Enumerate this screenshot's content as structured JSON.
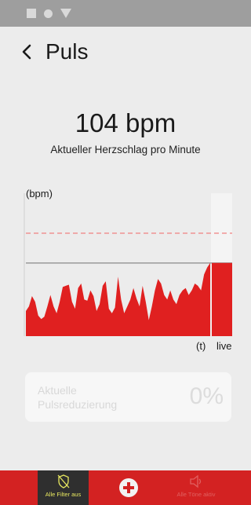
{
  "header": {
    "title": "Puls"
  },
  "heart_rate": {
    "value": "104 bpm",
    "caption": "Aktueller Herzschlag pro Minute"
  },
  "chart_data": {
    "type": "area",
    "ylabel": "(bpm)",
    "xlabel": "(t)",
    "live_label": "live",
    "series": [
      {
        "values": [
          62,
          66,
          75,
          70,
          58,
          55,
          57,
          66,
          76,
          66,
          60,
          70,
          83,
          84,
          85,
          70,
          64,
          82,
          86,
          72,
          71,
          80,
          75,
          62,
          68,
          84,
          88,
          64,
          60,
          65,
          92,
          72,
          60,
          66,
          72,
          82,
          73,
          66,
          84,
          70,
          54,
          66,
          80,
          90,
          86,
          76,
          72,
          80,
          72,
          68,
          76,
          80,
          82,
          76,
          80,
          86,
          84,
          80,
          94,
          100,
          104
        ]
      }
    ],
    "live_value": 104,
    "reference_value": 104,
    "threshold_value": 130,
    "ylim": [
      40,
      165
    ],
    "colors": {
      "fill": "#e02020",
      "threshold": "#f08a8a",
      "reference": "#9a9a9a",
      "live_band": "#f4f4f4"
    }
  },
  "reduction": {
    "label": "Aktuelle Pulsreduzierung",
    "value": "0%"
  },
  "bottom_nav": {
    "filter": {
      "label": "Alle Filter aus",
      "icon": "shield-off-icon"
    },
    "add": {
      "icon": "plus-circle-icon"
    },
    "sound": {
      "label": "Alle Töne aktiv",
      "icon": "speaker-icon"
    }
  }
}
